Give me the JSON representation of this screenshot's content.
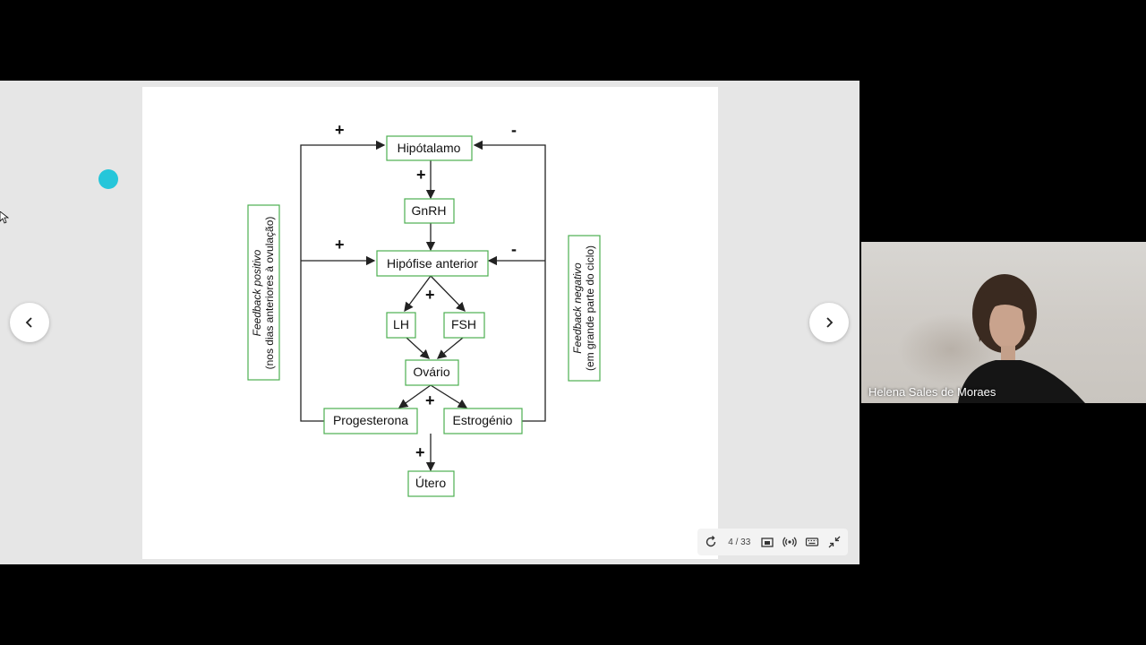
{
  "slide": {
    "diagram": {
      "boxes": {
        "hipotalamo": "Hipótalamo",
        "gnrh": "GnRH",
        "hipofise": "Hipófise anterior",
        "lh": "LH",
        "fsh": "FSH",
        "ovario": "Ovário",
        "progesterona": "Progesterona",
        "estrogenio": "Estrogénio",
        "utero": "Útero"
      },
      "signs": {
        "plus": "+",
        "minus": "-"
      },
      "feedback_positive": {
        "line1": "Feedback positivo",
        "line2": "(nos dias anteriores à ovulação)"
      },
      "feedback_negative": {
        "line1": "Feedback negativo",
        "line2": "(em grande parte do ciclo)"
      }
    }
  },
  "toolbar": {
    "page_indicator": "4 / 33",
    "icons": [
      "refresh-icon",
      "page-view-icon",
      "broadcast-icon",
      "keyboard-icon",
      "minimize-icon"
    ]
  },
  "video": {
    "participant_name": "Helena Sales de Moraes"
  },
  "colors": {
    "box_border": "#4caf50",
    "laser": "#26c6da"
  }
}
